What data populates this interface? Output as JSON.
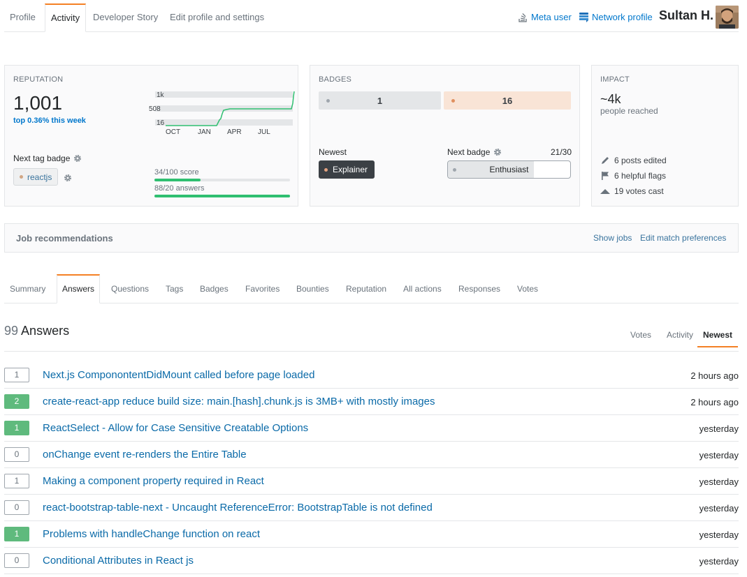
{
  "tabs": [
    {
      "label": "Profile"
    },
    {
      "label": "Activity",
      "active": true
    },
    {
      "label": "Developer Story"
    },
    {
      "label": "Edit profile and settings"
    }
  ],
  "header": {
    "meta_user": "Meta user",
    "network_profile": "Network profile",
    "username": "Sultan H."
  },
  "reputation": {
    "title": "Reputation",
    "value": "1,001",
    "week": "top 0.36% this week",
    "graph": {
      "y_labels": [
        "1k",
        "508",
        "16"
      ],
      "x_labels": [
        "OCT",
        "JAN",
        "APR",
        "JUL"
      ]
    },
    "next_tag_badge_label": "Next tag badge",
    "tag": "reactjs",
    "score_label": "34/100 score",
    "score_fraction": 0.34,
    "answers_label": "88/20 answers",
    "answers_fraction": 1.0
  },
  "badges": {
    "title": "Badges",
    "silver_count": "1",
    "bronze_count": "16",
    "newest_label": "Newest",
    "newest_badge": "Explainer",
    "next_badge_label": "Next badge",
    "next_badge_count": "21/30",
    "next_badge_name": "Enthusiast",
    "next_badge_fraction": 0.7
  },
  "impact": {
    "title": "Impact",
    "value": "~4k",
    "subtitle": "people reached",
    "posts_edited": "6 posts edited",
    "helpful_flags": "6 helpful flags",
    "votes_cast": "19 votes cast"
  },
  "jobs": {
    "title": "Job recommendations",
    "show_jobs": "Show jobs",
    "edit_prefs": "Edit match preferences"
  },
  "subtabs": [
    {
      "label": "Summary"
    },
    {
      "label": "Answers",
      "active": true
    },
    {
      "label": "Questions"
    },
    {
      "label": "Tags"
    },
    {
      "label": "Badges"
    },
    {
      "label": "Favorites"
    },
    {
      "label": "Bounties"
    },
    {
      "label": "Reputation"
    },
    {
      "label": "All actions"
    },
    {
      "label": "Responses"
    },
    {
      "label": "Votes"
    }
  ],
  "answers": {
    "count": "99",
    "label": "Answers",
    "sort": [
      {
        "label": "Votes"
      },
      {
        "label": "Activity"
      },
      {
        "label": "Newest",
        "active": true
      }
    ],
    "items": [
      {
        "votes": "1",
        "accepted": false,
        "title": "Next.js ComponontentDidMount called before page loaded",
        "time": "2 hours ago"
      },
      {
        "votes": "2",
        "accepted": true,
        "title": "create-react-app reduce build size: main.[hash].chunk.js is 3MB+ with mostly images",
        "time": "2 hours ago"
      },
      {
        "votes": "1",
        "accepted": true,
        "title": "ReactSelect - Allow for Case Sensitive Creatable Options",
        "time": "yesterday"
      },
      {
        "votes": "0",
        "accepted": false,
        "title": "onChange event re-renders the Entire Table",
        "time": "yesterday"
      },
      {
        "votes": "1",
        "accepted": false,
        "title": "Making a component property required in React",
        "time": "yesterday"
      },
      {
        "votes": "0",
        "accepted": false,
        "title": "react-bootstrap-table-next - Uncaught ReferenceError: BootstrapTable is not defined",
        "time": "yesterday"
      },
      {
        "votes": "1",
        "accepted": true,
        "title": "Problems with handleChange function on react",
        "time": "yesterday"
      },
      {
        "votes": "0",
        "accepted": false,
        "title": "Conditional Attributes in React js",
        "time": "yesterday"
      }
    ]
  },
  "colors": {
    "accent": "#f48024",
    "link": "#0077cc",
    "accepted": "#5fba7d",
    "progress": "#2fbf71",
    "silver_badge_bg": "#e4e6e8",
    "bronze_badge_bg": "#f9e4d6"
  }
}
